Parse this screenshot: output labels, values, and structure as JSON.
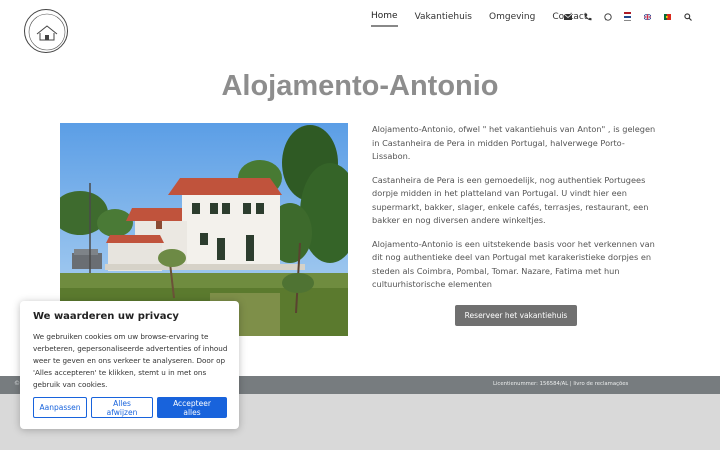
{
  "nav": {
    "items": [
      "Home",
      "Vakantiehuis",
      "Omgeving",
      "Contact"
    ],
    "icons": [
      "envelope-icon",
      "phone-icon",
      "whatsapp-icon"
    ],
    "flags": [
      "nl-flag-icon",
      "en-flag-icon",
      "pt-flag-icon"
    ],
    "search_icon": "search-icon"
  },
  "colors": {
    "title": "#8d8d8d",
    "accent_button": "#1863dc",
    "cta_button": "#707070",
    "footer": "#777c7f"
  },
  "main": {
    "title": "Alojamento-Antonio",
    "paragraphs": [
      "Alojamento-Antonio,   ofwel \" het vakantiehuis van Anton\" , is gelegen in Castanheira de Pera in midden Portugal, halverwege Porto-Lissabon.",
      "Castanheira de Pera is een gemoedelijk, nog authentiek Portugees dorpje midden in het platteland van Portugal.  U vindt hier een supermarkt, bakker, slager, enkele cafés, terrasjes, restaurant, een bakker en nog diversen andere winkeltjes.",
      "Alojamento-Antonio is een uitstekende basis voor het verkennen van dit nog authentieke deel van Portugal met karakeristieke dorpjes en steden als Coimbra, Pombal, Tomar. Nazare, Fatima met hun cultuurhistorische elementen"
    ],
    "cta_label": "Reserveer het vakantiehuis"
  },
  "footer": {
    "left": "©",
    "license": "Licentienummer: 156584/AL",
    "separator": "|",
    "complaints": "livro de reclamações"
  },
  "cookie": {
    "title": "We waarderen uw privacy",
    "text": "We gebruiken cookies om uw browse-ervaring te verbeteren, gepersonaliseerde advertenties of inhoud weer te geven en ons verkeer te analyseren. Door op 'Alles accepteren' te klikken, stemt u in met ons gebruik van cookies.",
    "customize_label": "Aanpassen",
    "reject_label": "Alles afwijzen",
    "accept_label": "Accepteer alles"
  }
}
